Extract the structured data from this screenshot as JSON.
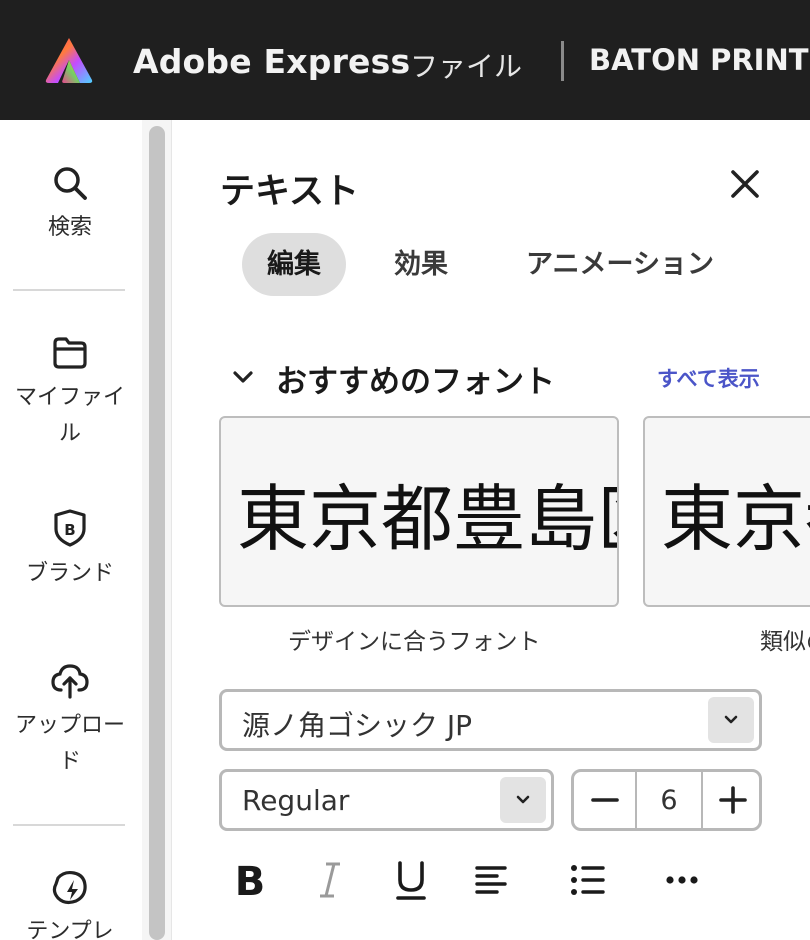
{
  "topbar": {
    "app_name": "Adobe Express",
    "menu_file": "ファイル",
    "doc_title": "BATON PRINT SA",
    "logo_icon": "adobe-express-logo"
  },
  "rail": {
    "items": [
      {
        "label": "検索",
        "icon": "search-icon"
      },
      {
        "label": "マイファイル",
        "icon": "folder-icon"
      },
      {
        "label": "ブランド",
        "icon": "brand-icon"
      },
      {
        "label": "アップロード",
        "icon": "cloud-upload-icon"
      },
      {
        "label": "テンプレ",
        "icon": "template-icon"
      }
    ]
  },
  "panel": {
    "title": "テキスト",
    "close_icon": "close-icon",
    "tabs": [
      {
        "label": "編集",
        "active": true
      },
      {
        "label": "効果",
        "active": false
      },
      {
        "label": "アニメーション",
        "active": false
      }
    ],
    "section": {
      "title": "おすすめのフォント",
      "show_all": "すべて表示"
    },
    "font_cards": [
      {
        "sample": "東京都豊島区",
        "caption": "デザインに合うフォント"
      },
      {
        "sample": "東京都",
        "caption": "類似の"
      }
    ],
    "font_family": "源ノ角ゴシック JP",
    "font_weight": "Regular",
    "font_size": "6",
    "format_buttons": [
      "bold-icon",
      "italic-icon",
      "underline-icon",
      "align-left-icon",
      "list-icon",
      "more-icon"
    ]
  },
  "colors": {
    "topbar_bg": "#1f1f1f",
    "link": "#4b55c8",
    "active_tab": "#dedede"
  }
}
